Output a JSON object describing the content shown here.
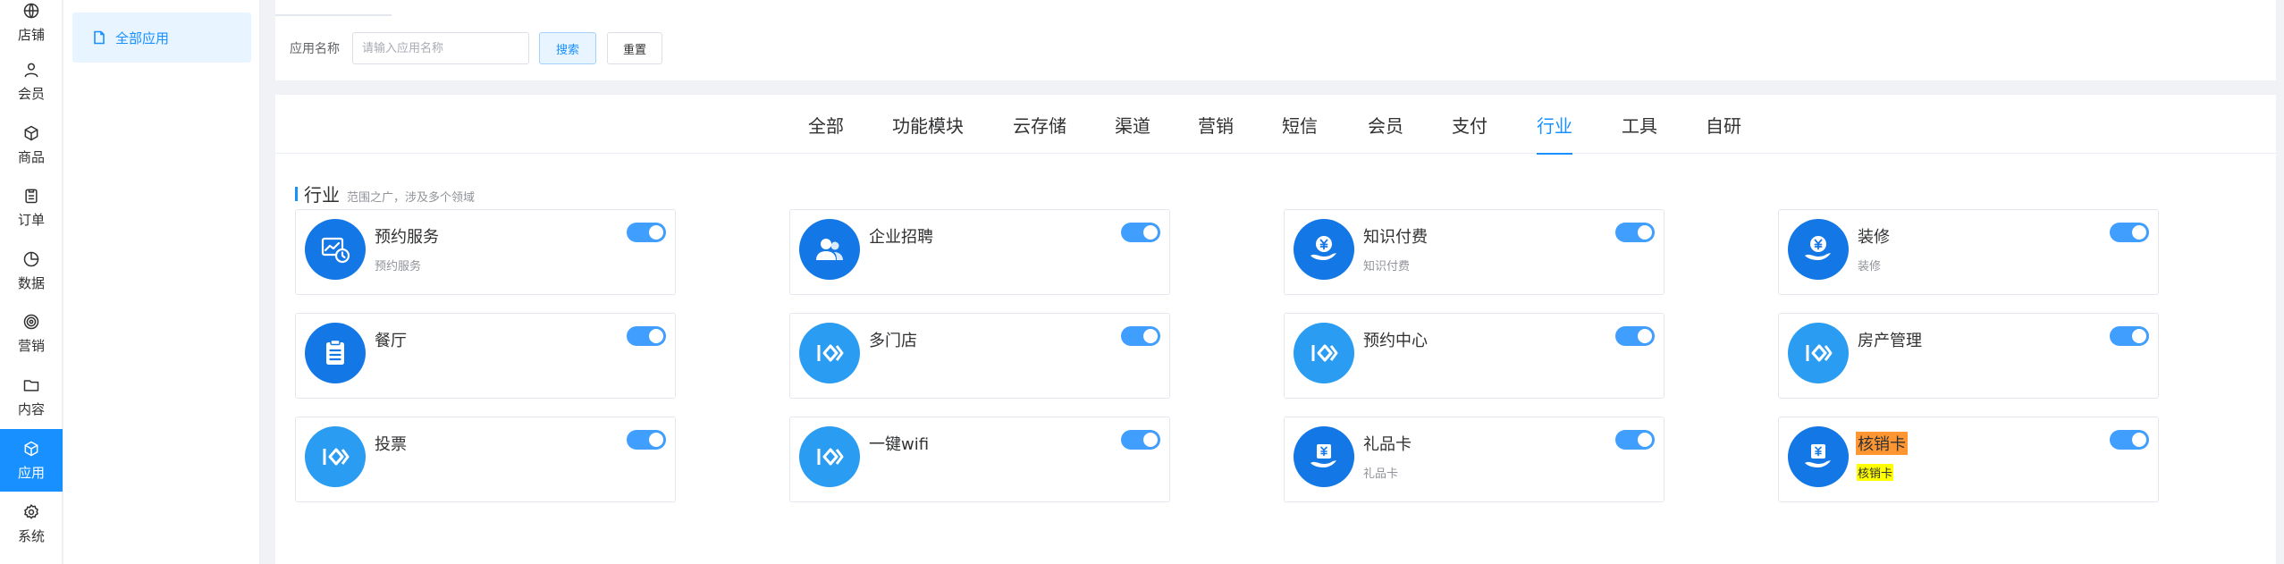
{
  "rail": [
    {
      "label": "店铺",
      "icon": "globe-icon"
    },
    {
      "label": "会员",
      "icon": "user-icon"
    },
    {
      "label": "商品",
      "icon": "cube-icon"
    },
    {
      "label": "订单",
      "icon": "clipboard-icon"
    },
    {
      "label": "数据",
      "icon": "pie-chart-icon"
    },
    {
      "label": "营销",
      "icon": "target-icon"
    },
    {
      "label": "内容",
      "icon": "folder-icon"
    },
    {
      "label": "应用",
      "icon": "cube-icon",
      "active": true
    },
    {
      "label": "系统",
      "icon": "gear-icon"
    }
  ],
  "subnav": {
    "item": "全部应用"
  },
  "search": {
    "label": "应用名称",
    "placeholder": "请输入应用名称",
    "value": "",
    "search_btn": "搜索",
    "reset_btn": "重置"
  },
  "tabs": [
    {
      "label": "全部"
    },
    {
      "label": "功能模块"
    },
    {
      "label": "云存储"
    },
    {
      "label": "渠道"
    },
    {
      "label": "营销"
    },
    {
      "label": "短信"
    },
    {
      "label": "会员"
    },
    {
      "label": "支付"
    },
    {
      "label": "行业",
      "active": true
    },
    {
      "label": "工具"
    },
    {
      "label": "自研"
    }
  ],
  "section": {
    "title": "行业",
    "desc": "范围之广，涉及多个领域"
  },
  "apps": [
    {
      "name": "预约服务",
      "sub": "预约服务",
      "icon": "appointment-icon",
      "enabled": true
    },
    {
      "name": "企业招聘",
      "sub": "",
      "icon": "people-icon",
      "enabled": true
    },
    {
      "name": "知识付费",
      "sub": "知识付费",
      "icon": "yen-hand-icon",
      "enabled": true
    },
    {
      "name": "装修",
      "sub": "装修",
      "icon": "yen-hand-icon",
      "enabled": true
    },
    {
      "name": "餐厅",
      "sub": "",
      "icon": "clipboard-icon",
      "enabled": true
    },
    {
      "name": "多门店",
      "sub": "",
      "icon": "k-logo-icon",
      "enabled": true
    },
    {
      "name": "预约中心",
      "sub": "",
      "icon": "k-logo-icon",
      "enabled": true
    },
    {
      "name": "房产管理",
      "sub": "",
      "icon": "k-logo-icon",
      "enabled": true
    },
    {
      "name": "投票",
      "sub": "",
      "icon": "k-logo-icon",
      "enabled": true
    },
    {
      "name": "一键wifi",
      "sub": "",
      "icon": "k-logo-icon",
      "enabled": true
    },
    {
      "name": "礼品卡",
      "sub": "礼品卡",
      "icon": "card-hand-icon",
      "enabled": true
    },
    {
      "name": "核销卡",
      "sub": "核销卡",
      "icon": "card-hand-icon",
      "enabled": true,
      "highlighted": true
    }
  ],
  "colors": {
    "accent": "#1890ff",
    "switch_on": "#409eff",
    "icon_dark": "#1377e6",
    "icon_light": "#2a9cf2",
    "highlight_name": "#ff9632",
    "highlight_sub": "#ffff00"
  }
}
